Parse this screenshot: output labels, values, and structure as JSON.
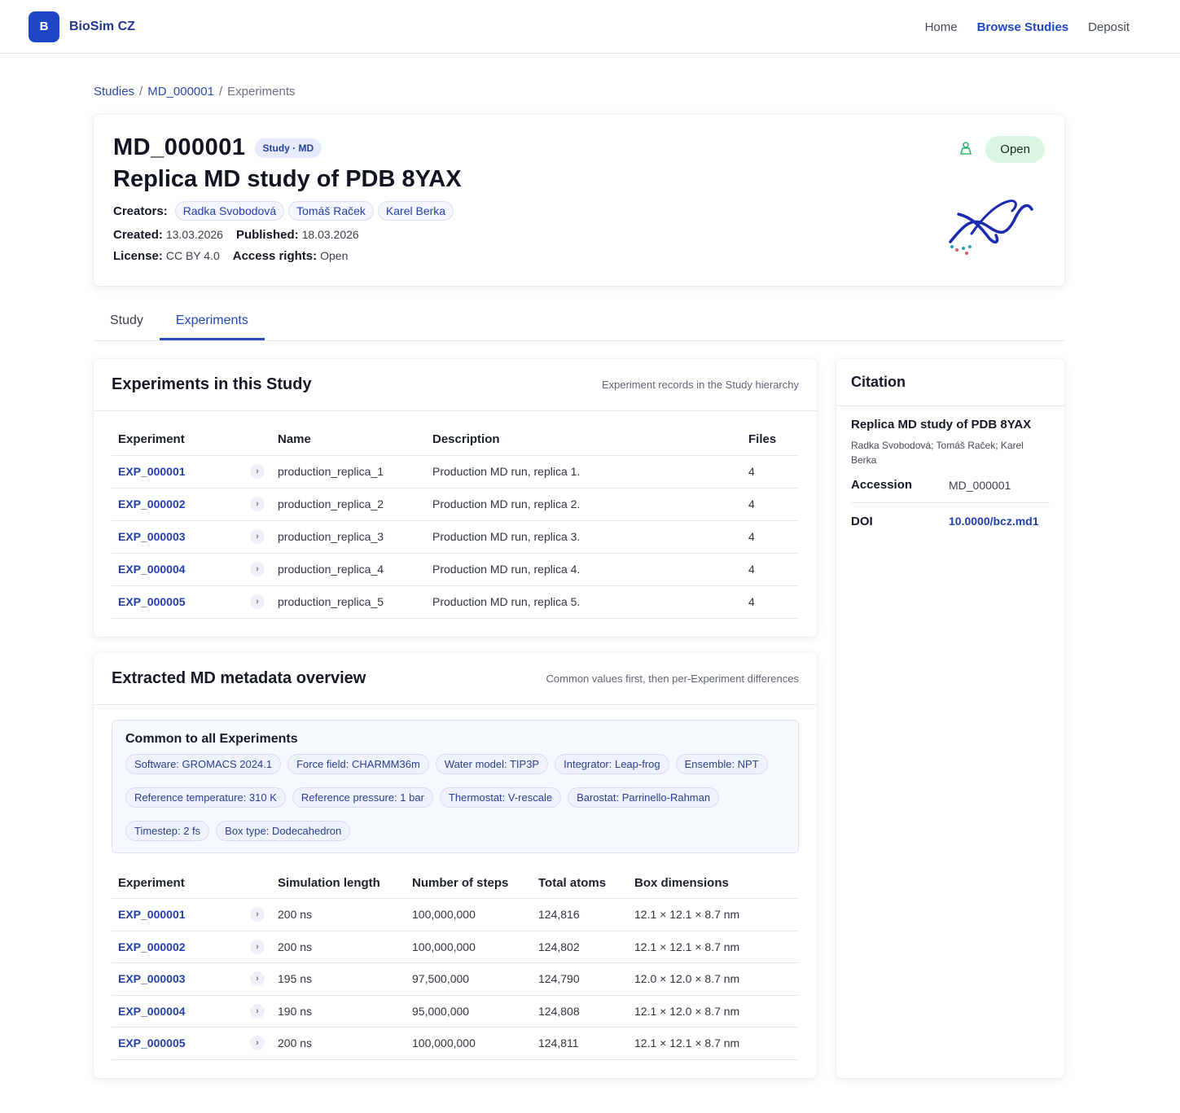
{
  "app": {
    "logo_letter": "B",
    "name": "BioSim CZ"
  },
  "nav": {
    "items": [
      "Home",
      "Browse Studies",
      "Deposit"
    ],
    "active": "Browse Studies"
  },
  "breadcrumb": {
    "studies": "Studies",
    "sep": "/",
    "study": "MD_000001",
    "current": "Experiments"
  },
  "study": {
    "id": "MD_000001",
    "type_badge": "Study · MD",
    "title": "Replica MD study of PDB 8YAX",
    "creators_label": "Creators:",
    "creators": [
      "Radka Svobodová",
      "Tomáš Raček",
      "Karel Berka"
    ],
    "created_label": "Created:",
    "created": "13.03.2026",
    "published_label": "Published:",
    "published": "18.03.2026",
    "license_label": "License:",
    "license": "CC BY 4.0",
    "access_label": "Access rights:",
    "access": "Open",
    "status_badge": "Open"
  },
  "tabs": [
    {
      "label": "Study"
    },
    {
      "label": "Experiments"
    }
  ],
  "experiments_card": {
    "title": "Experiments in this Study",
    "subtitle": "Experiment records in the Study hierarchy",
    "columns": [
      "Experiment",
      "Name",
      "Description",
      "Files"
    ],
    "rows": [
      {
        "id": "EXP_000001",
        "name": "production_replica_1",
        "description": "Production MD run, replica 1.",
        "files": "4"
      },
      {
        "id": "EXP_000002",
        "name": "production_replica_2",
        "description": "Production MD run, replica 2.",
        "files": "4"
      },
      {
        "id": "EXP_000003",
        "name": "production_replica_3",
        "description": "Production MD run, replica 3.",
        "files": "4"
      },
      {
        "id": "EXP_000004",
        "name": "production_replica_4",
        "description": "Production MD run, replica 4.",
        "files": "4"
      },
      {
        "id": "EXP_000005",
        "name": "production_replica_5",
        "description": "Production MD run, replica 5.",
        "files": "4"
      }
    ]
  },
  "metadata_card": {
    "title": "Extracted MD metadata overview",
    "subtitle": "Common values first, then per-Experiment differences",
    "common_title": "Common to all Experiments",
    "common": [
      "Software: GROMACS 2024.1",
      "Force field: CHARMM36m",
      "Water model: TIP3P",
      "Integrator: Leap-frog",
      "Ensemble: NPT",
      "Reference temperature: 310 K",
      "Reference pressure: 1 bar",
      "Thermostat: V-rescale",
      "Barostat: Parrinello-Rahman",
      "Timestep: 2 fs",
      "Box type: Dodecahedron"
    ],
    "columns": [
      "Experiment",
      "Simulation length",
      "Number of steps",
      "Total atoms",
      "Box dimensions"
    ],
    "rows": [
      {
        "id": "EXP_000001",
        "length": "200 ns",
        "steps": "100,000,000",
        "atoms": "124,816",
        "box": "12.1 × 12.1 × 8.7 nm"
      },
      {
        "id": "EXP_000002",
        "length": "200 ns",
        "steps": "100,000,000",
        "atoms": "124,802",
        "box": "12.1 × 12.1 × 8.7 nm"
      },
      {
        "id": "EXP_000003",
        "length": "195 ns",
        "steps": "97,500,000",
        "atoms": "124,790",
        "box": "12.0 × 12.0 × 8.7 nm"
      },
      {
        "id": "EXP_000004",
        "length": "190 ns",
        "steps": "95,000,000",
        "atoms": "124,808",
        "box": "12.1 × 12.0 × 8.7 nm"
      },
      {
        "id": "EXP_000005",
        "length": "200 ns",
        "steps": "100,000,000",
        "atoms": "124,811",
        "box": "12.1 × 12.1 × 8.7 nm"
      }
    ]
  },
  "citation": {
    "heading": "Citation",
    "title": "Replica MD study of PDB 8YAX",
    "authors": "Radka Svobodová; Tomáš Raček; Karel Berka",
    "accession_label": "Accession",
    "accession": "MD_000001",
    "doi_label": "DOI",
    "doi": "10.0000/bcz.md1"
  },
  "icons": {
    "chevron": "›",
    "open_access": "person-icon",
    "molecule": "molecule-icon"
  },
  "colors": {
    "brand": "#1e47c8",
    "open": "#dbf7e4",
    "link": "#2341a6"
  }
}
